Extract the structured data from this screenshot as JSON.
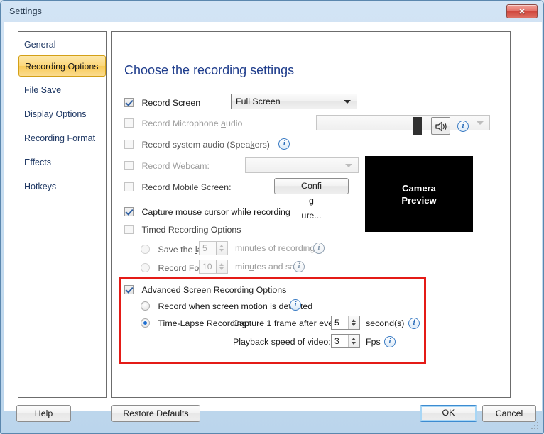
{
  "window": {
    "title": "Settings",
    "close_label": "✕"
  },
  "sidebar": {
    "items": [
      {
        "label": "General",
        "selected": false
      },
      {
        "label": "Recording Options",
        "selected": true
      },
      {
        "label": "File Save",
        "selected": false
      },
      {
        "label": "Display Options",
        "selected": false
      },
      {
        "label": "Recording Format",
        "selected": false
      },
      {
        "label": "Effects",
        "selected": false
      },
      {
        "label": "Hotkeys",
        "selected": false
      }
    ]
  },
  "main": {
    "heading": "Choose the recording settings",
    "record_screen": {
      "label": "Record Screen",
      "checked": true,
      "mode_value": "Full Screen"
    },
    "record_microphone": {
      "label_pre": "Record Microphone ",
      "label_mnemonic": "a",
      "label_post": "udio",
      "checked": false,
      "device_value": ""
    },
    "record_system_audio": {
      "label_pre": "Record system audio (Spea",
      "label_mnemonic": "k",
      "label_post": "ers)",
      "checked": false,
      "info": "info-icon"
    },
    "record_webcam": {
      "label": "Record Webcam:",
      "checked": false,
      "device_value": ""
    },
    "record_mobile": {
      "label_pre": "Record Mobile Scre",
      "label_mnemonic": "e",
      "label_post": "n:",
      "checked": false,
      "configure_pre": "Confi",
      "configure_mnemonic": "g",
      "configure_post": "ure..."
    },
    "capture_cursor": {
      "label": "Capture mouse cursor while recording",
      "checked": true
    },
    "timed_recording": {
      "label": "Timed Recording Options",
      "checked": false,
      "save_last": {
        "label_pre": "Save the ",
        "label_mnemonic": "l",
        "label_post": "ast",
        "selected": false,
        "value": "5",
        "suffix": "minutes of recordings"
      },
      "record_for": {
        "label": "Record For",
        "selected": false,
        "value": "10",
        "suffix_pre": "min",
        "suffix_mnemonic": "u",
        "suffix_post": "tes and save"
      }
    },
    "advanced": {
      "label": "Advanced Screen Recording Options",
      "checked": true,
      "motion_detect": {
        "label": "Record when screen motion is detected",
        "selected": false
      },
      "time_lapse": {
        "label": "Time-Lapse Recording:",
        "selected": true,
        "capture_label": "Capture 1 frame after every",
        "capture_value": "5",
        "capture_unit": "second(s)",
        "playback_label": "Playback speed of video:",
        "playback_value": "3",
        "playback_unit": "Fps"
      },
      "highlight_color": "#e41b17"
    },
    "camera_preview": {
      "line1": "Camera",
      "line2": "Preview"
    }
  },
  "footer": {
    "help": "Help",
    "restore_defaults": "Restore Defaults",
    "ok": "OK",
    "cancel": "Cancel"
  }
}
